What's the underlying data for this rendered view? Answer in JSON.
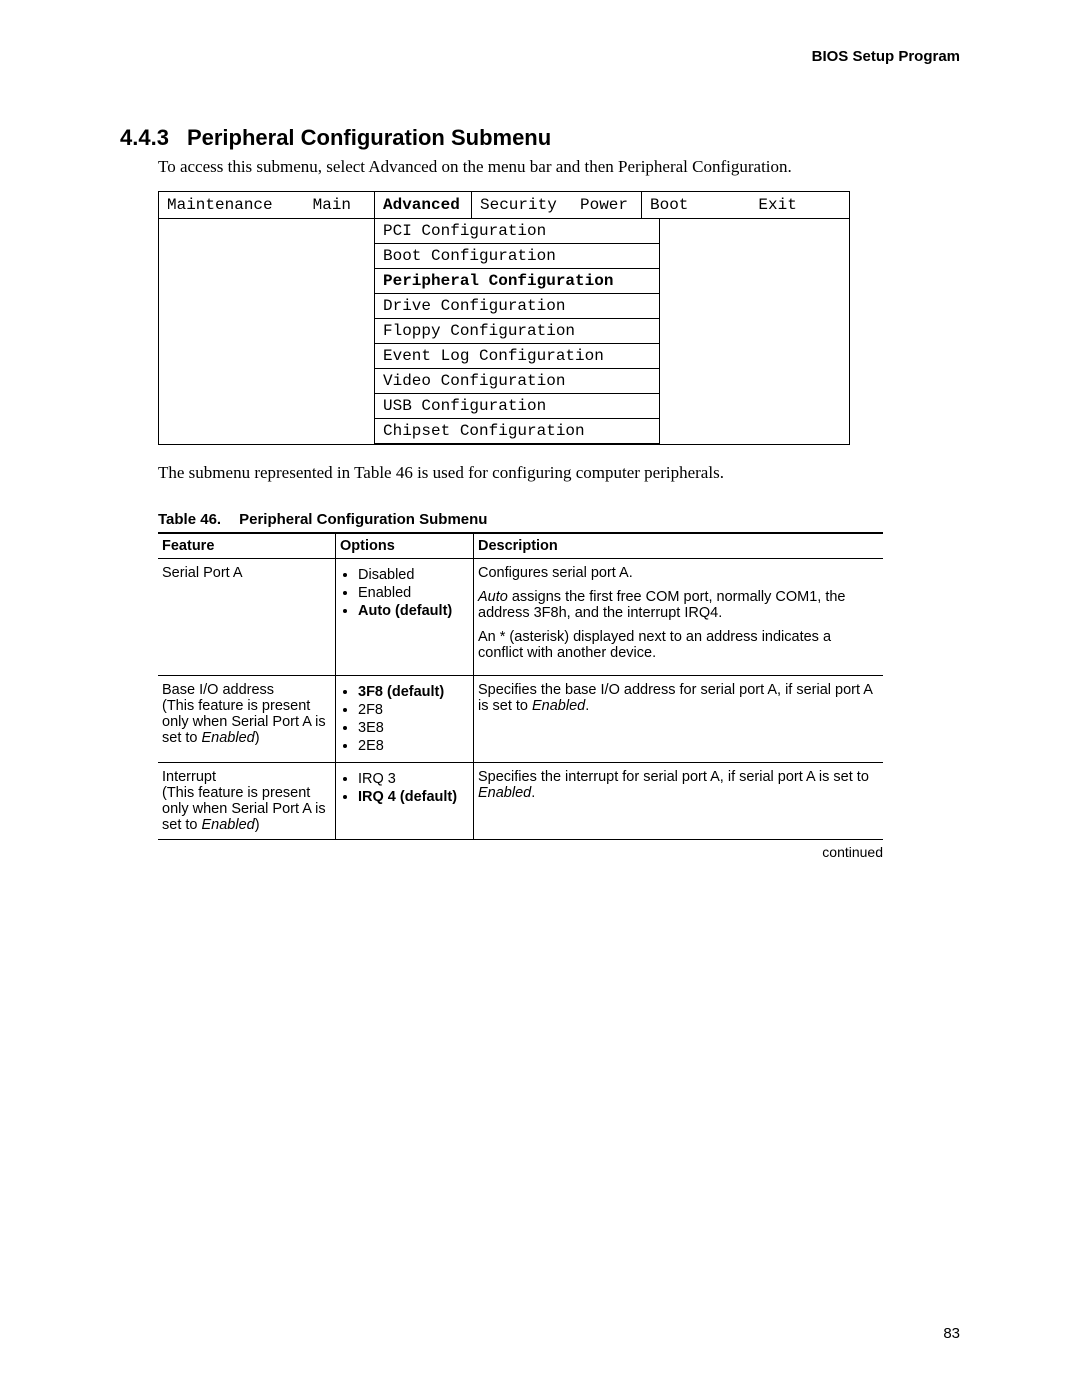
{
  "header": {
    "running": "BIOS Setup Program"
  },
  "section": {
    "number": "4.4.3",
    "title": "Peripheral Configuration Submenu",
    "intro": "To access this submenu, select Advanced on the menu bar and then Peripheral Configuration."
  },
  "menubar": {
    "maintenance": "Maintenance",
    "main": "Main",
    "advanced": "Advanced",
    "security": "Security",
    "power": "Power",
    "boot": "Boot",
    "exit": "Exit"
  },
  "submenu": {
    "items": [
      "PCI Configuration",
      "Boot Configuration",
      "Peripheral Configuration",
      "Drive Configuration",
      "Floppy Configuration",
      "Event Log Configuration",
      "Video Configuration",
      "USB Configuration",
      "Chipset Configuration"
    ],
    "selected_index": 2
  },
  "after_text": "The submenu represented in Table 46 is used for configuring computer peripherals.",
  "table": {
    "label_prefix": "Table 46.",
    "label_title": "Peripheral Configuration Submenu",
    "head": {
      "feature": "Feature",
      "options": "Options",
      "description": "Description"
    },
    "rows": [
      {
        "feature_main": "Serial Port A",
        "feature_note": "",
        "options": [
          {
            "text": "Disabled",
            "bold": false
          },
          {
            "text": "Enabled",
            "bold": false
          },
          {
            "text": "Auto (default)",
            "bold": true
          }
        ],
        "description": [
          {
            "runs": [
              {
                "t": "Configures serial port A."
              }
            ]
          },
          {
            "runs": [
              {
                "t": "Auto",
                "i": true
              },
              {
                "t": " assigns the first free COM port, normally COM1, the address 3F8h, and the interrupt IRQ4."
              }
            ]
          },
          {
            "runs": [
              {
                "t": "An * (asterisk) displayed next to an address indicates a conflict with another device."
              }
            ]
          }
        ]
      },
      {
        "feature_main": "Base I/O address",
        "feature_note_runs": [
          {
            "t": "(This feature is present only when Serial Port A is set to "
          },
          {
            "t": "Enabled",
            "i": true
          },
          {
            "t": ")"
          }
        ],
        "options": [
          {
            "text": "3F8 (default)",
            "bold": true
          },
          {
            "text": "2F8",
            "bold": false
          },
          {
            "text": "3E8",
            "bold": false
          },
          {
            "text": "2E8",
            "bold": false
          }
        ],
        "description": [
          {
            "runs": [
              {
                "t": "Specifies the base I/O address for serial port A, if serial port A is set to "
              },
              {
                "t": "Enabled",
                "i": true
              },
              {
                "t": "."
              }
            ]
          }
        ]
      },
      {
        "feature_main": "Interrupt",
        "feature_note_runs": [
          {
            "t": "(This feature is present only when Serial Port A is set to "
          },
          {
            "t": "Enabled",
            "i": true
          },
          {
            "t": ")"
          }
        ],
        "options": [
          {
            "text": "IRQ 3",
            "bold": false
          },
          {
            "text": "IRQ 4 (default)",
            "bold": true
          }
        ],
        "description": [
          {
            "runs": [
              {
                "t": "Specifies the interrupt for serial port A, if serial port A is set to "
              },
              {
                "t": "Enabled",
                "i": true
              },
              {
                "t": "."
              }
            ]
          }
        ]
      }
    ],
    "continued": "continued"
  },
  "page_number": "83"
}
